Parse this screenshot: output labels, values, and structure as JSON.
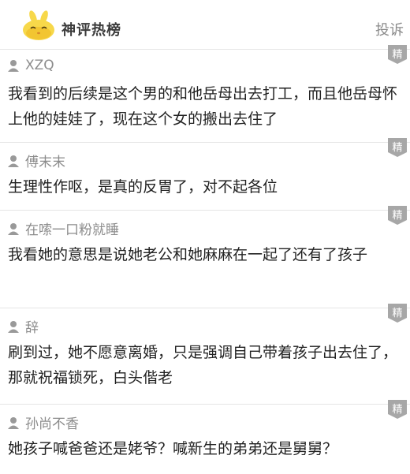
{
  "header": {
    "brand": "神评热榜",
    "report_label": "投诉"
  },
  "comments": [
    {
      "username": "XZQ",
      "badge": "精",
      "text": "我看到的后续是这个男的和他岳母出去打工，而且他岳母怀上他的娃娃了，现在这个女的搬出去住了"
    },
    {
      "username": "傅末末",
      "badge": "精",
      "text": "生理性作呕，是真的反胃了，对不起各位"
    },
    {
      "username": "在嗦一口粉就睡",
      "badge": "精",
      "text": "我看她的意思是说她老公和她麻麻在一起了还有了孩子"
    },
    {
      "username": "辞",
      "badge": "精",
      "text": "刷到过，她不愿意离婚，只是强调自己带着孩子出去住了，那就祝福锁死，白头偕老"
    },
    {
      "username": "孙尚不香",
      "badge": "精",
      "text": "她孩子喊爸爸还是姥爷？喊新生的弟弟还是舅舅？"
    }
  ]
}
